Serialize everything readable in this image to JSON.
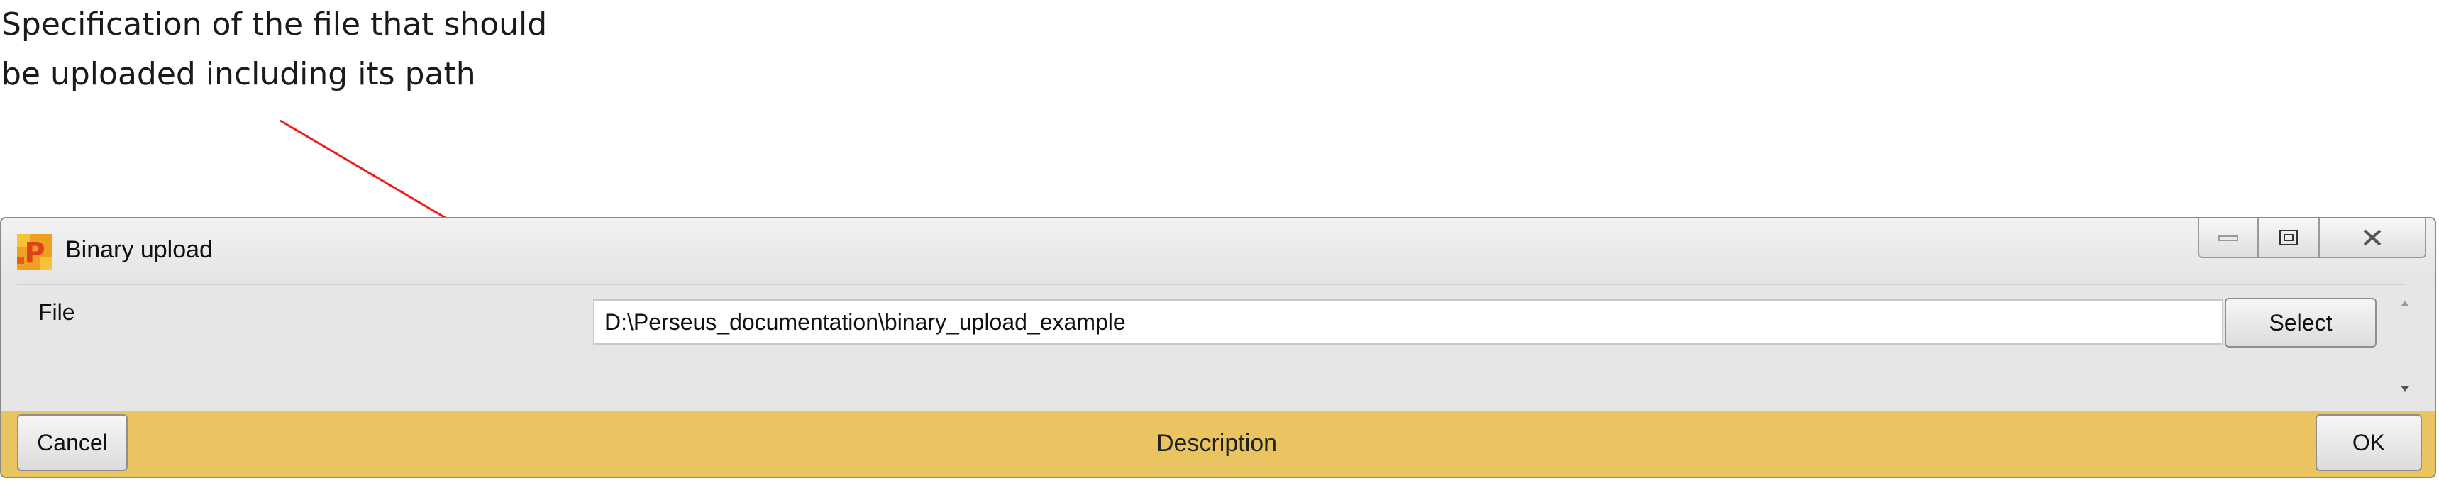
{
  "annotation": {
    "line1": "Specification of the file that should",
    "line2": "be uploaded including its path",
    "arrow_color": "#e8211c"
  },
  "window": {
    "title": "Binary upload",
    "icon": "perseus-app-icon",
    "caption_buttons": [
      "minimize-icon",
      "restore-icon",
      "close-icon"
    ]
  },
  "form": {
    "file_label": "File",
    "file_value": "D:\\Perseus_documentation\\binary_upload_example",
    "select_label": "Select"
  },
  "footer": {
    "cancel_label": "Cancel",
    "description_label": "Description",
    "ok_label": "OK",
    "color": "#ebc462"
  }
}
